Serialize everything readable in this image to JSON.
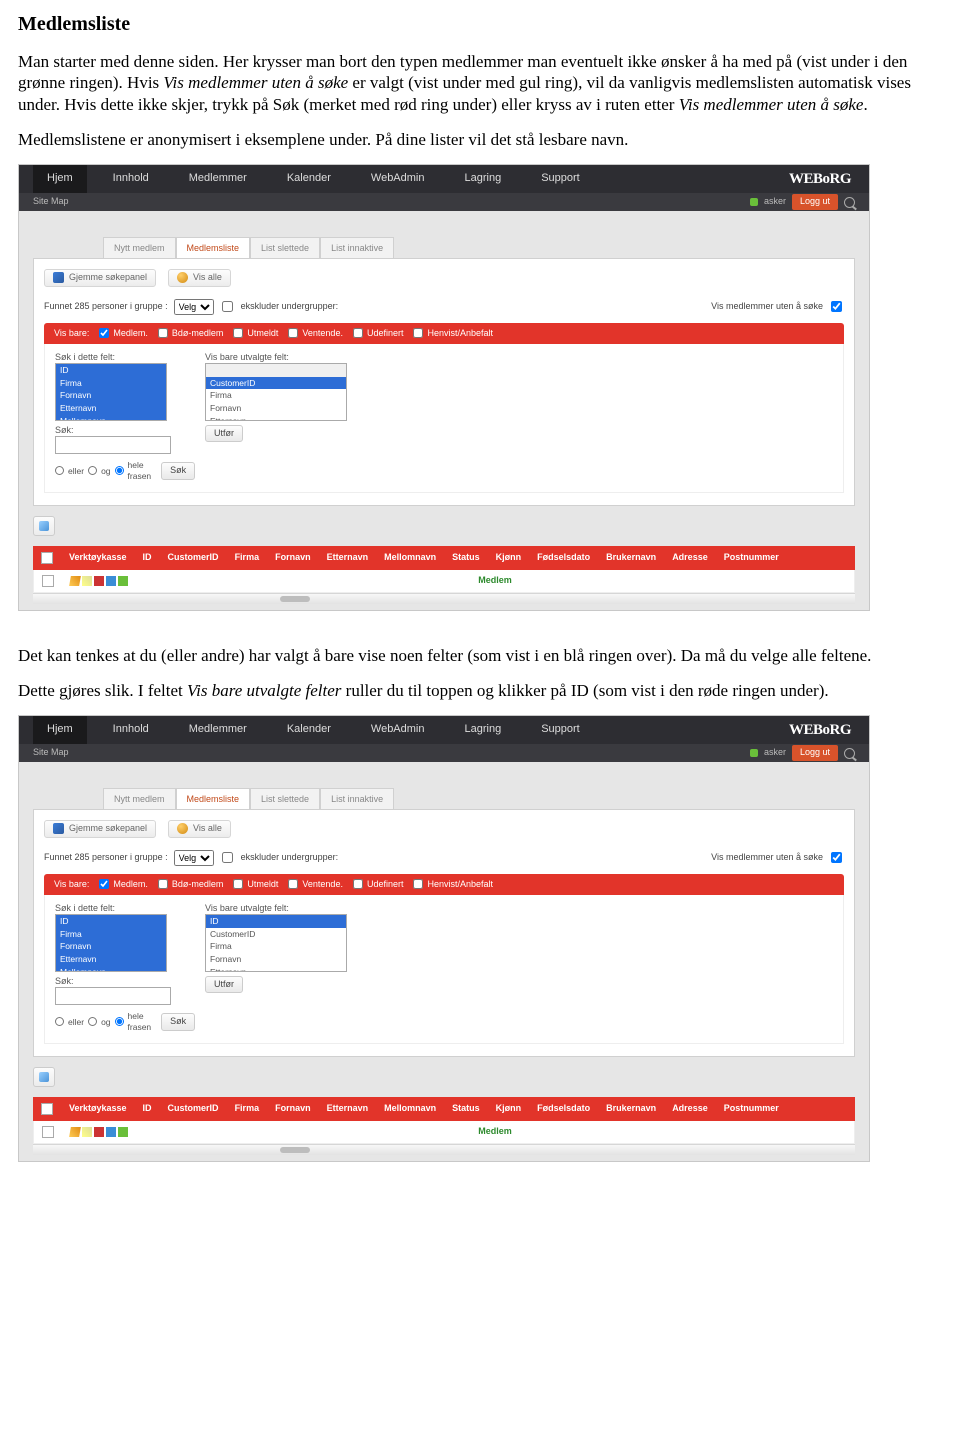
{
  "doc": {
    "title": "Medlemsliste",
    "p1a": "Man starter med denne siden. Her krysser man bort den typen medlemmer man eventuelt ikke ønsker å ha med på (vist under i den grønne ringen). Hvis ",
    "p1i1": "Vis medlemmer uten å søke",
    "p1b": " er valgt (vist under med gul ring), vil da vanligvis medlemslisten automatisk vises under. Hvis dette ikke skjer, trykk på Søk (merket med rød ring under) eller kryss av i ruten etter ",
    "p1i2": "Vis medlemmer uten å søke",
    "p1c": ".",
    "p2": "Medlemslistene er anonymisert i eksemplene under. På dine lister vil det stå lesbare navn.",
    "p3": "Det kan tenkes at du (eller andre) har valgt å bare vise noen felter (som vist i en blå ringen over). Da må du velge alle feltene.",
    "p4a": "Dette gjøres slik. I feltet ",
    "p4i": "Vis bare utvalgte felter",
    "p4b": " ruller du til toppen og klikker på ID (som vist i den røde ringen under)."
  },
  "shared": {
    "nav": [
      "Hjem",
      "Innhold",
      "Medlemmer",
      "Kalender",
      "WebAdmin",
      "Lagring",
      "Support"
    ],
    "logo": "WEBoRG",
    "sitemap": "Site Map",
    "username": "asker",
    "logout": "Logg ut",
    "subtabs": [
      "Nytt medlem",
      "Medlemsliste",
      "List slettede",
      "List innaktive"
    ],
    "toolbar": {
      "hide": "Gjemme søkepanel",
      "showall": "Vis alle"
    },
    "result_prefix": "Funnet 285 personer i gruppe :",
    "select_value": "Velg",
    "exclude_sub": "ekskluder undergrupper:",
    "vis_uten": "Vis medlemmer uten å søke",
    "redbar": {
      "visbare": "Vis bare:",
      "items": [
        "Medlem.",
        "Bdø-medlem",
        "Utmeldt",
        "Ventende.",
        "Udefinert",
        "Henvist/Anbefalt"
      ]
    },
    "search_label": "Søk i dette felt:",
    "fields": [
      "ID",
      "Firma",
      "Fornavn",
      "Etternavn",
      "Mellomnavn"
    ],
    "search2": "Søk:",
    "opt_eller": "eller",
    "opt_og": "og",
    "opt_hele": "hele frasen",
    "btn_sok": "Søk",
    "visbarefelt": "Vis bare utvalgte felt:",
    "vf_fields": [
      "CustomerID",
      "Firma",
      "Fornavn",
      "Etternavn"
    ],
    "btn_utfor": "Utfør",
    "table_cols": [
      "Verktøykasse",
      "ID",
      "CustomerID",
      "Firma",
      "Fornavn",
      "Etternavn",
      "Mellomnavn",
      "Status",
      "Kjønn",
      "Fødselsdato",
      "Brukernavn",
      "Adresse",
      "Postnummer"
    ],
    "status_cell": "Medlem"
  },
  "shot2": {
    "vf_fields_top": [
      "ID",
      "CustomerID",
      "Firma",
      "Fornavn",
      "Etternavn"
    ]
  }
}
